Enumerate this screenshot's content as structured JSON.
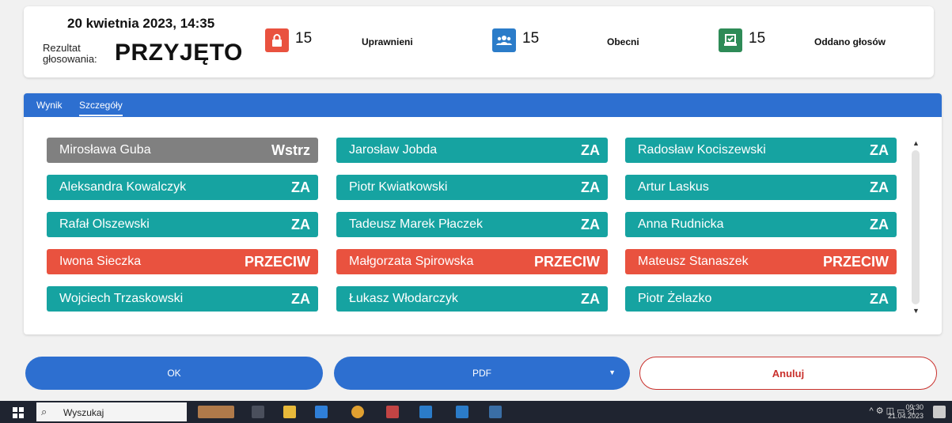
{
  "header": {
    "datetime": "20 kwietnia 2023, 14:35",
    "result_label": "Rezultat głosowania:",
    "result_value": "PRZYJĘTO",
    "stats": [
      {
        "icon": "lock-icon",
        "count": "15",
        "label": "Uprawnieni",
        "color": "#e9523f"
      },
      {
        "icon": "people-icon",
        "count": "15",
        "label": "Obecni",
        "color": "#2b7cc9"
      },
      {
        "icon": "ballot-icon",
        "count": "15",
        "label": "Oddano głosów",
        "color": "#2e8b57"
      }
    ]
  },
  "tabs": [
    {
      "label": "Wynik",
      "active": false
    },
    {
      "label": "Szczegóły",
      "active": true
    }
  ],
  "votes": [
    [
      {
        "name": "Mirosława Guba",
        "vote": "Wstrz"
      },
      {
        "name": "Aleksandra Kowalczyk",
        "vote": "ZA"
      },
      {
        "name": "Rafał Olszewski",
        "vote": "ZA"
      },
      {
        "name": "Iwona Sieczka",
        "vote": "PRZECIW"
      },
      {
        "name": "Wojciech Trzaskowski",
        "vote": "ZA"
      }
    ],
    [
      {
        "name": "Jarosław Jobda",
        "vote": "ZA"
      },
      {
        "name": "Piotr Kwiatkowski",
        "vote": "ZA"
      },
      {
        "name": "Tadeusz Marek Płaczek",
        "vote": "ZA"
      },
      {
        "name": "Małgorzata Spirowska",
        "vote": "PRZECIW"
      },
      {
        "name": "Łukasz Włodarczyk",
        "vote": "ZA"
      }
    ],
    [
      {
        "name": "Radosław Kociszewski",
        "vote": "ZA"
      },
      {
        "name": "Artur Laskus",
        "vote": "ZA"
      },
      {
        "name": "Anna Rudnicka",
        "vote": "ZA"
      },
      {
        "name": "Mateusz Stanaszek",
        "vote": "PRZECIW"
      },
      {
        "name": "Piotr Żelazko",
        "vote": "ZA"
      }
    ]
  ],
  "buttons": {
    "ok": "OK",
    "pdf": "PDF",
    "cancel": "Anuluj"
  },
  "taskbar": {
    "search_placeholder": "Wyszukaj",
    "time": "09:30",
    "date": "21.04.2023"
  }
}
